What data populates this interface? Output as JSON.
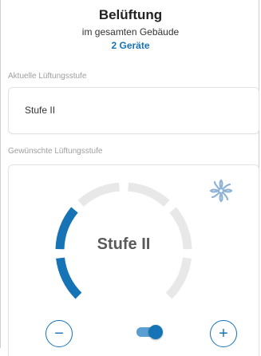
{
  "header": {
    "title": "Belüftung",
    "subtitle": "im gesamten Gebäude",
    "devices": "2 Geräte"
  },
  "current": {
    "label": "Aktuelle Lüftungsstufe",
    "value": "Stufe II"
  },
  "desired": {
    "label": "Gewünschte Lüftungsstufe",
    "gauge_value": "Stufe II",
    "fan_icon": "fan-icon",
    "minus_label": "−",
    "plus_label": "+",
    "auto_toggle_on": true
  },
  "colors": {
    "accent": "#1673b6",
    "inactive_segment": "#e8e8e8"
  },
  "gauge": {
    "segments_total": 6,
    "segments_active": 2
  }
}
